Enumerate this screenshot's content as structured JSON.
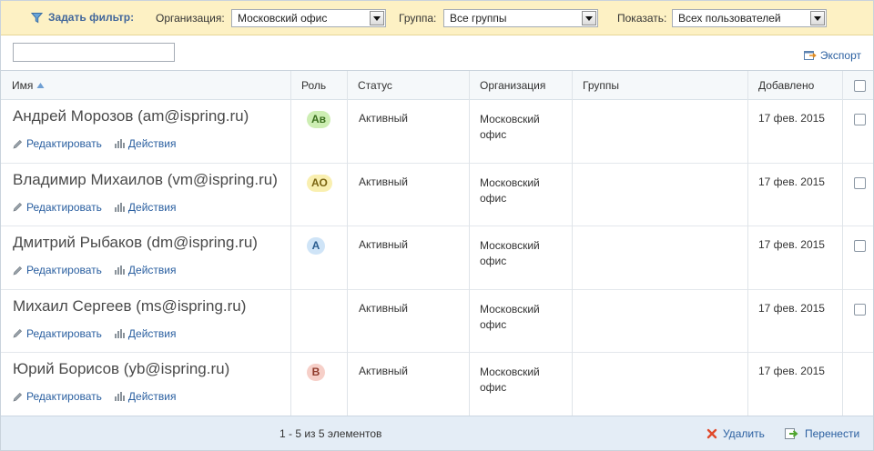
{
  "filter": {
    "toggle_label": "Задать фильтр:",
    "org_label": "Организация:",
    "org_value": "Московский офис",
    "group_label": "Группа:",
    "group_value": "Все группы",
    "show_label": "Показать:",
    "show_value": "Всех пользователей"
  },
  "toolbar": {
    "search_value": "",
    "export_label": "Экспорт"
  },
  "columns": {
    "name": "Имя",
    "role": "Роль",
    "status": "Статус",
    "org": "Организация",
    "groups": "Группы",
    "added": "Добавлено"
  },
  "row_actions": {
    "edit": "Редактировать",
    "actions": "Действия"
  },
  "rows": [
    {
      "name": "Андрей Морозов (am@ispring.ru)",
      "role": "Ав",
      "status": "Активный",
      "org": "Московский офис",
      "groups": "",
      "added": "17 фев. 2015",
      "checkbox": true
    },
    {
      "name": "Владимир Михаилов (vm@ispring.ru)",
      "role": "АО",
      "status": "Активный",
      "org": "Московский офис",
      "groups": "",
      "added": "17 фев. 2015",
      "checkbox": true
    },
    {
      "name": "Дмитрий Рыбаков (dm@ispring.ru)",
      "role": "А",
      "status": "Активный",
      "org": "Московский офис",
      "groups": "",
      "added": "17 фев. 2015",
      "checkbox": true
    },
    {
      "name": "Михаил Сергеев (ms@ispring.ru)",
      "role": "",
      "status": "Активный",
      "org": "Московский офис",
      "groups": "",
      "added": "17 фев. 2015",
      "checkbox": true
    },
    {
      "name": "Юрий Борисов (yb@ispring.ru)",
      "role": "В",
      "status": "Активный",
      "org": "Московский офис",
      "groups": "",
      "added": "17 фев. 2015",
      "checkbox": false
    }
  ],
  "role_colors": {
    "Ав": {
      "bg": "#cdeeb3",
      "fg": "#3a6f1e"
    },
    "АО": {
      "bg": "#f9efb0",
      "fg": "#7a6412"
    },
    "А": {
      "bg": "#cfe4f7",
      "fg": "#2b5d8f"
    },
    "В": {
      "bg": "#f6cfc8",
      "fg": "#8f3a2b"
    }
  },
  "footer": {
    "pager": "1 - 5 из 5 элементов",
    "delete_label": "Удалить",
    "move_label": "Перенести"
  }
}
